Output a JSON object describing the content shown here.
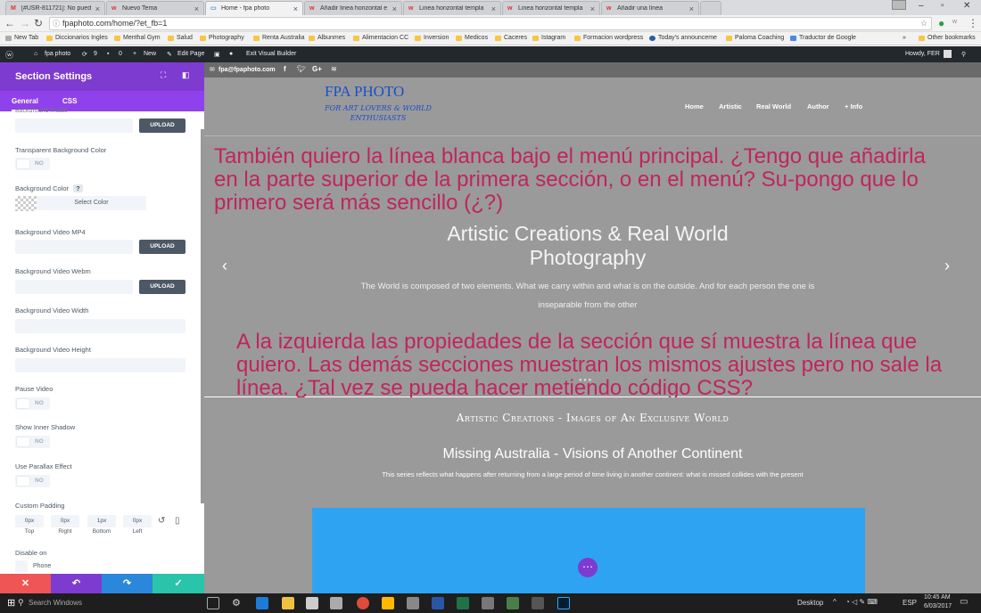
{
  "browser": {
    "tabs": [
      {
        "label": "[#USR-811721]: No pued",
        "active": false
      },
      {
        "label": "Nuevo Tema",
        "active": false
      },
      {
        "label": "Home - fpa photo",
        "active": true
      },
      {
        "label": "Añadir linea horizontal e",
        "active": false
      },
      {
        "label": "Linea horizontal templa",
        "active": false
      },
      {
        "label": "Linea horizontal templa",
        "active": false
      },
      {
        "label": "Añadir una línea",
        "active": false
      }
    ],
    "url": "fpaphoto.com/home/?et_fb=1",
    "bookmarks": [
      "New Tab",
      "Diccionarios Ingles",
      "Menthal Gym",
      "Salud",
      "Photography",
      "Renta Australia",
      "Albunmes",
      "Alimentacion CC",
      "Inversion",
      "Medicos",
      "Caceres",
      "Istagram",
      "Formacion wordpress",
      "Today's announceme",
      "Paloma Coaching",
      "Traductor de Google"
    ],
    "bookmarks_more": "»",
    "other_bookmarks": "Other bookmarks"
  },
  "wp_admin_bar": {
    "site_name": "fpa photo",
    "updates": "9",
    "comments": "0",
    "new_label": "New",
    "edit_page": "Edit Page",
    "exit_builder": "Exit Visual Builder",
    "howdy": "Howdy, FER"
  },
  "panel": {
    "title": "Section Settings",
    "tabs": [
      "General",
      "CSS"
    ],
    "top_cut_label": "Background Image",
    "upload": "UPLOAD",
    "transparent_bg_label": "Transparent Background Color",
    "toggle_no": "NO",
    "bg_color_label": "Background Color",
    "help": "?",
    "select_color": "Select Color",
    "bg_video_mp4": "Background Video MP4",
    "bg_video_webm": "Background Video Webm",
    "bg_video_width": "Background Video Width",
    "bg_video_height": "Background Video Height",
    "pause_video": "Pause Video",
    "inner_shadow": "Show Inner Shadow",
    "parallax": "Use Parallax Effect",
    "custom_padding": "Custom Padding",
    "padding": [
      {
        "value": "0px",
        "label": "Top"
      },
      {
        "value": "0px",
        "label": "Right"
      },
      {
        "value": "1px",
        "label": "Bottom"
      },
      {
        "value": "0px",
        "label": "Left"
      }
    ],
    "disable_on": "Disable on",
    "phone": "Phone"
  },
  "site": {
    "email": "fpa@fpaphoto.com",
    "social": [
      "f",
      "t",
      "G+",
      "rss"
    ],
    "logo_title": "FPA PHOTO",
    "logo_tagline": "FOR ART LOVERS & WORLD ENTHUSIASTS",
    "menu": [
      "Home",
      "Artistic",
      "Real World",
      "Author",
      "+ Info"
    ],
    "hero_title": "Artistic Creations & Real World Photography",
    "hero_text": "The World is composed of two elements. What we carry within and what is on the outside. And for each person the one is inseparable from the other",
    "annotation_top": "También quiero la línea blanca bajo el menú principal. ¿Tengo que añadirla en la parte superior de la primera sección, o en el menú? Su-pongo que lo primero será más sencillo (¿?)",
    "annotation_bottom": "A la izquierda las propiedades de la sección que sí muestra la línea que quiero. Las demás secciones muestran los mismos ajustes pero no sale la línea. ¿Tal vez se pueda hacer metiendo código CSS?",
    "section_heading": "Artistic Creations - Images of An Exclusive World",
    "section_title": "Missing Australia - Visions of Another Continent",
    "section_text": "This series reflects what happens after returning from a large period of time living in another continent: what is missed collides with the present"
  },
  "taskbar": {
    "search": "Search Windows",
    "desktop": "Desktop",
    "lang": "ESP",
    "time": "10:45 AM",
    "date": "6/03/2017"
  },
  "colors": {
    "panel_purple": "#7e3bd0",
    "cancel": "#ef5555",
    "undo": "#7e3bd0",
    "redo": "#2b87da",
    "save": "#29c4a9",
    "annotation": "#c0255e"
  }
}
